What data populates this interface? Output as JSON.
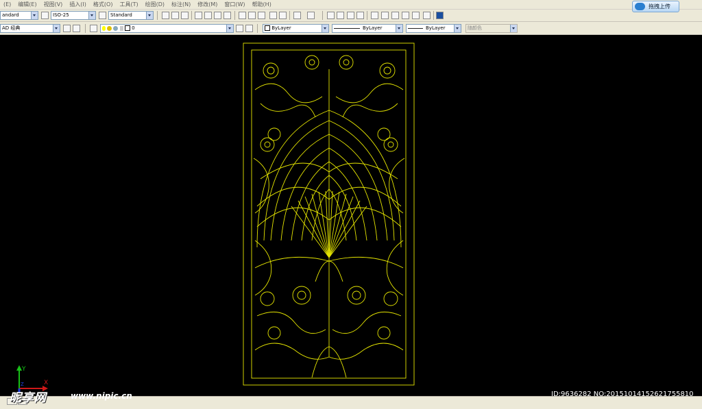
{
  "menu": [
    "(E)",
    "编辑(E)",
    "视图(V)",
    "插入(I)",
    "格式(O)",
    "工具(T)",
    "绘图(D)",
    "标注(N)",
    "修改(M)",
    "窗口(W)",
    "帮助(H)"
  ],
  "upload_button_label": "拖拽上传",
  "toolbar1": {
    "text_style": "andard",
    "dim_style": "ISO-25",
    "table_style": "Standard"
  },
  "toolbar2": {
    "workspace": "AD 经典",
    "layer": "0",
    "color": "ByLayer",
    "linetype": "ByLayer",
    "lineweight": "ByLayer",
    "plot_style": "随颜色"
  },
  "ucs": {
    "y_label": "Y",
    "x_label": "X",
    "z_label": "Z"
  },
  "colors": {
    "drawing": "#e6e600",
    "background": "#000000",
    "toolbar": "#ece9d8"
  },
  "watermark": {
    "logo": "昵享网",
    "url": "www.nipic.cn",
    "id_text": "ID:9636282 NO:20151014152621755810"
  }
}
